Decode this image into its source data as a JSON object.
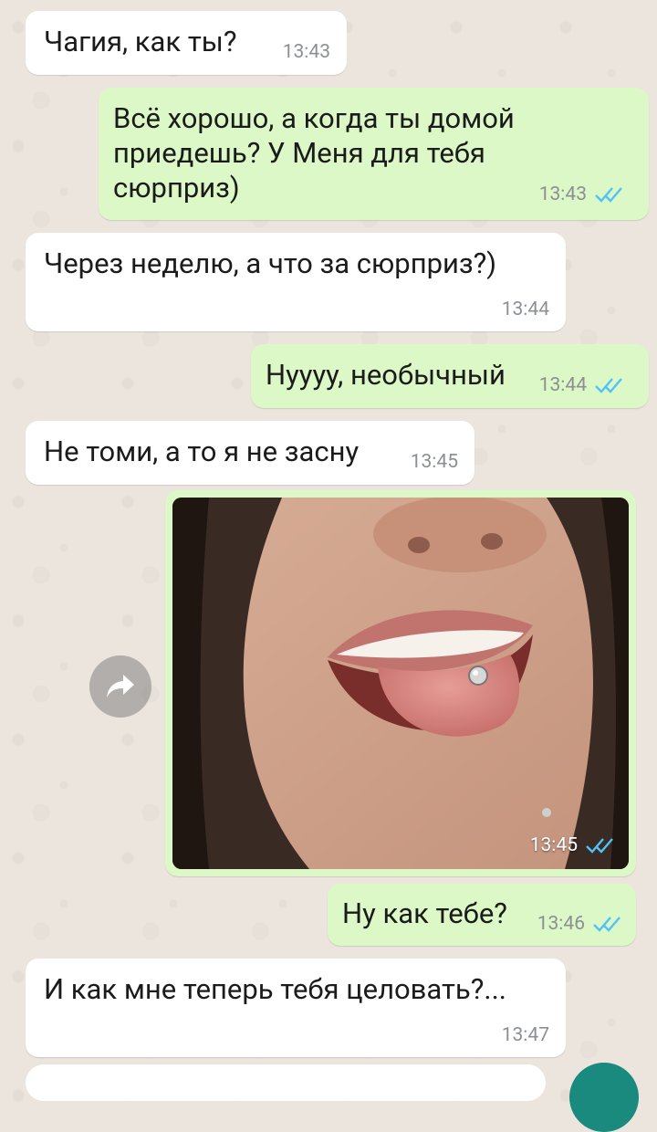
{
  "messages": [
    {
      "text": "Чагия, как ты?",
      "time": "13:43"
    },
    {
      "text": "Всё хорошо, а когда ты домой\nприедешь? У Меня для тебя\nсюрприз)",
      "time": "13:43"
    },
    {
      "text": "Через неделю, а что за сюрприз?)",
      "time": "13:44"
    },
    {
      "text": "Нуууу, необычный",
      "time": "13:44"
    },
    {
      "text": "Не томи, а то я не засну",
      "time": "13:45"
    },
    {
      "time": "13:45"
    },
    {
      "text": "Ну как тебе?",
      "time": "13:46"
    },
    {
      "text": "И как мне теперь тебя целовать?...",
      "time": "13:47"
    }
  ],
  "icons": {
    "read_receipt": "double-check-icon",
    "forward": "forward-arrow-icon"
  },
  "colors": {
    "incoming_bubble": "#ffffff",
    "outgoing_bubble": "#dcf8c6",
    "read_tick": "#4fc3f7",
    "wallpaper": "#ece5dd"
  }
}
